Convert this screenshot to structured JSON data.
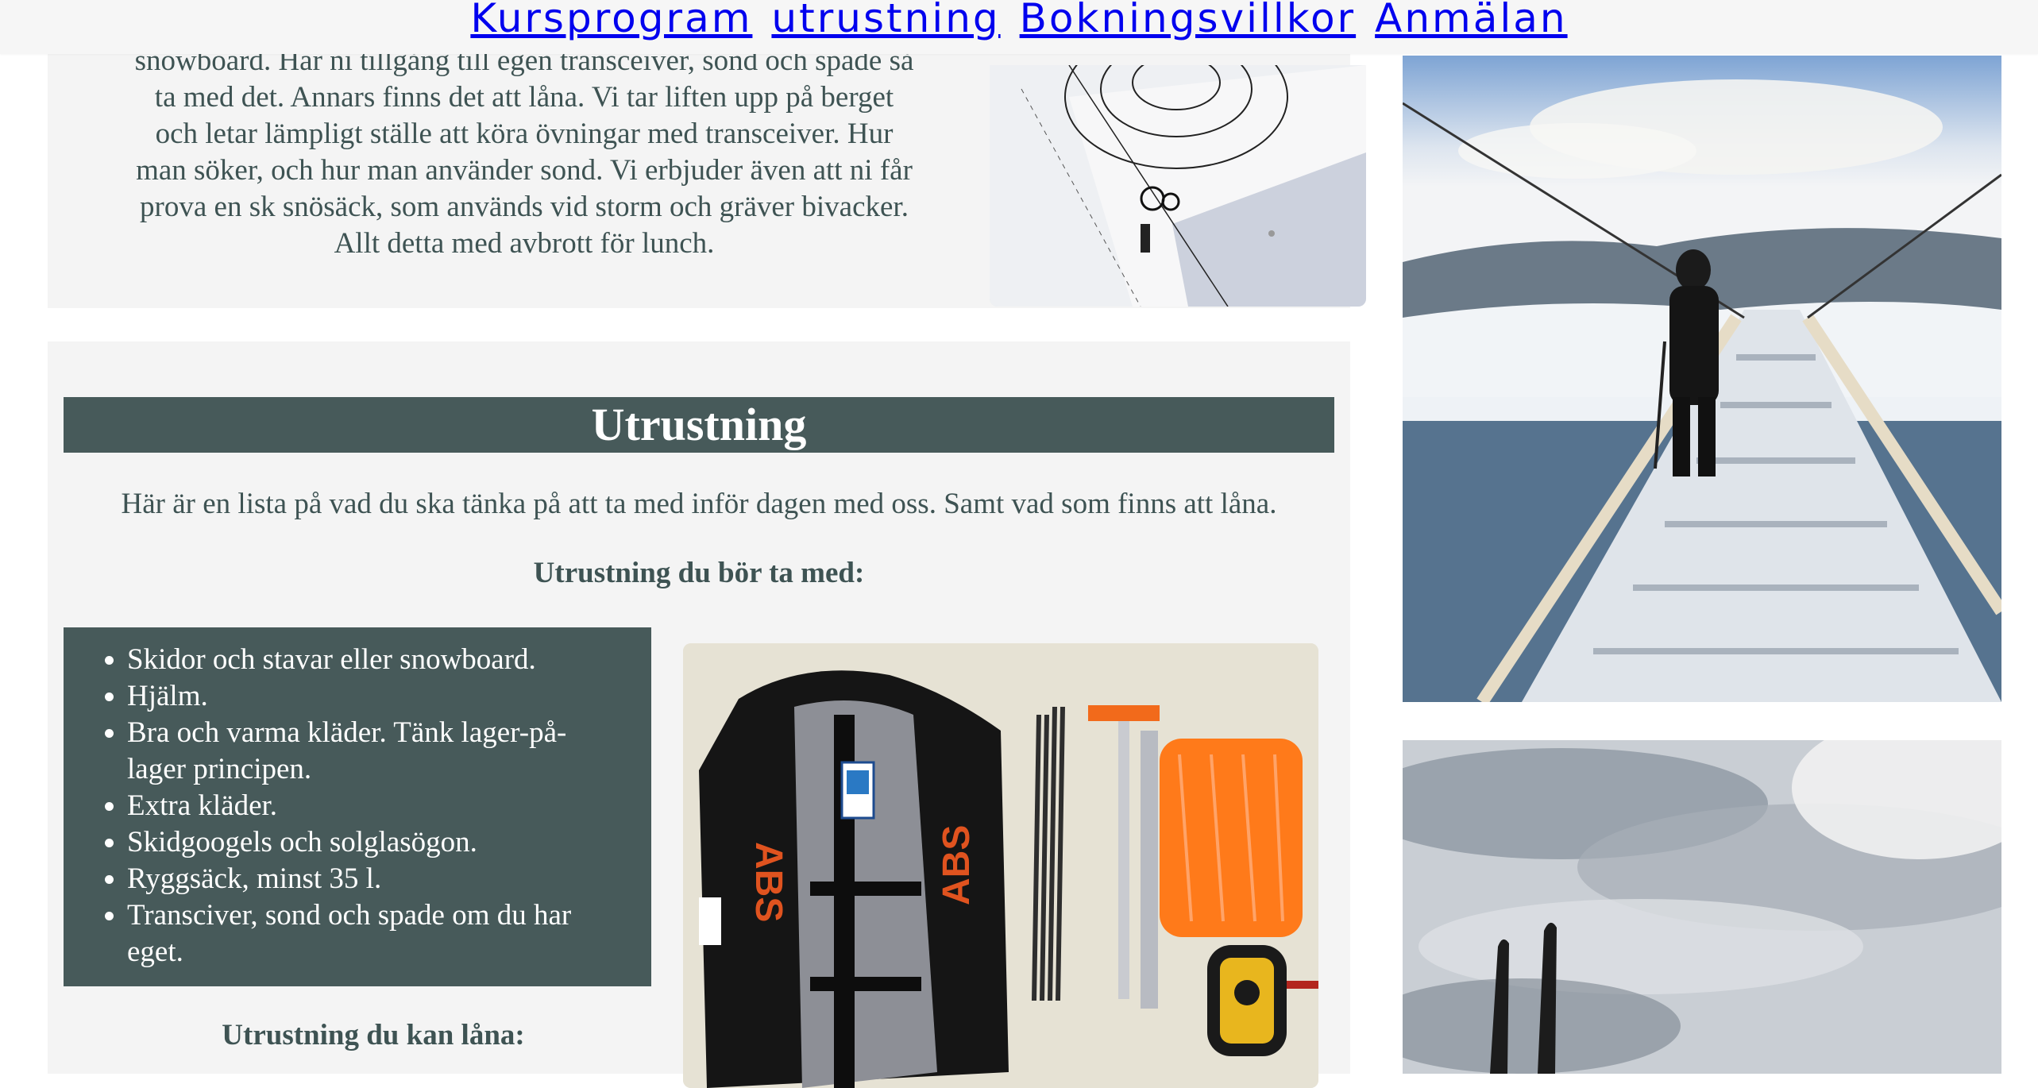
{
  "nav": {
    "links": [
      {
        "label": "Kursprogram"
      },
      {
        "label": "utrustning"
      },
      {
        "label": "Bokningsvillkor"
      },
      {
        "label": "Anmälan"
      }
    ]
  },
  "intro": {
    "lines": [
      "snowboard. Har ni tillgång till egen transceiver, sond och spade så",
      "ta med det. Annars finns det att låna. Vi tar liften upp på berget",
      "och letar lämpligt ställe att köra övningar med transceiver. Hur",
      "man söker, och hur man använder sond. Vi erbjuder även att ni får",
      "prova en sk snösäck, som används vid storm och gräver bivacker.",
      "Allt detta med avbrott för lunch."
    ]
  },
  "equipment": {
    "heading": "Utrustning",
    "lead": "Här är en lista på vad du ska tänka på att ta med inför dagen med oss. Samt vad som finns att låna.",
    "bring_heading": "Utrustning du bör ta med:",
    "bring_items": [
      "Skidor och stavar eller snowboard.",
      "Hjälm.",
      "Bra och varma kläder. Tänk lager-på-lager principen.",
      "Extra kläder.",
      "Skidgoogels och solglasögon.",
      "Ryggsäck, minst 35 l.",
      "Transciver, sond och spade om du har eget."
    ],
    "borrow_heading": "Utrustning du kan låna:"
  },
  "photos": {
    "gear_brand": "ABS"
  },
  "colors": {
    "panel_bg": "#f4f4f4",
    "accent_dark": "#475a5a",
    "text": "#3e5353",
    "link": "#0000ee"
  }
}
